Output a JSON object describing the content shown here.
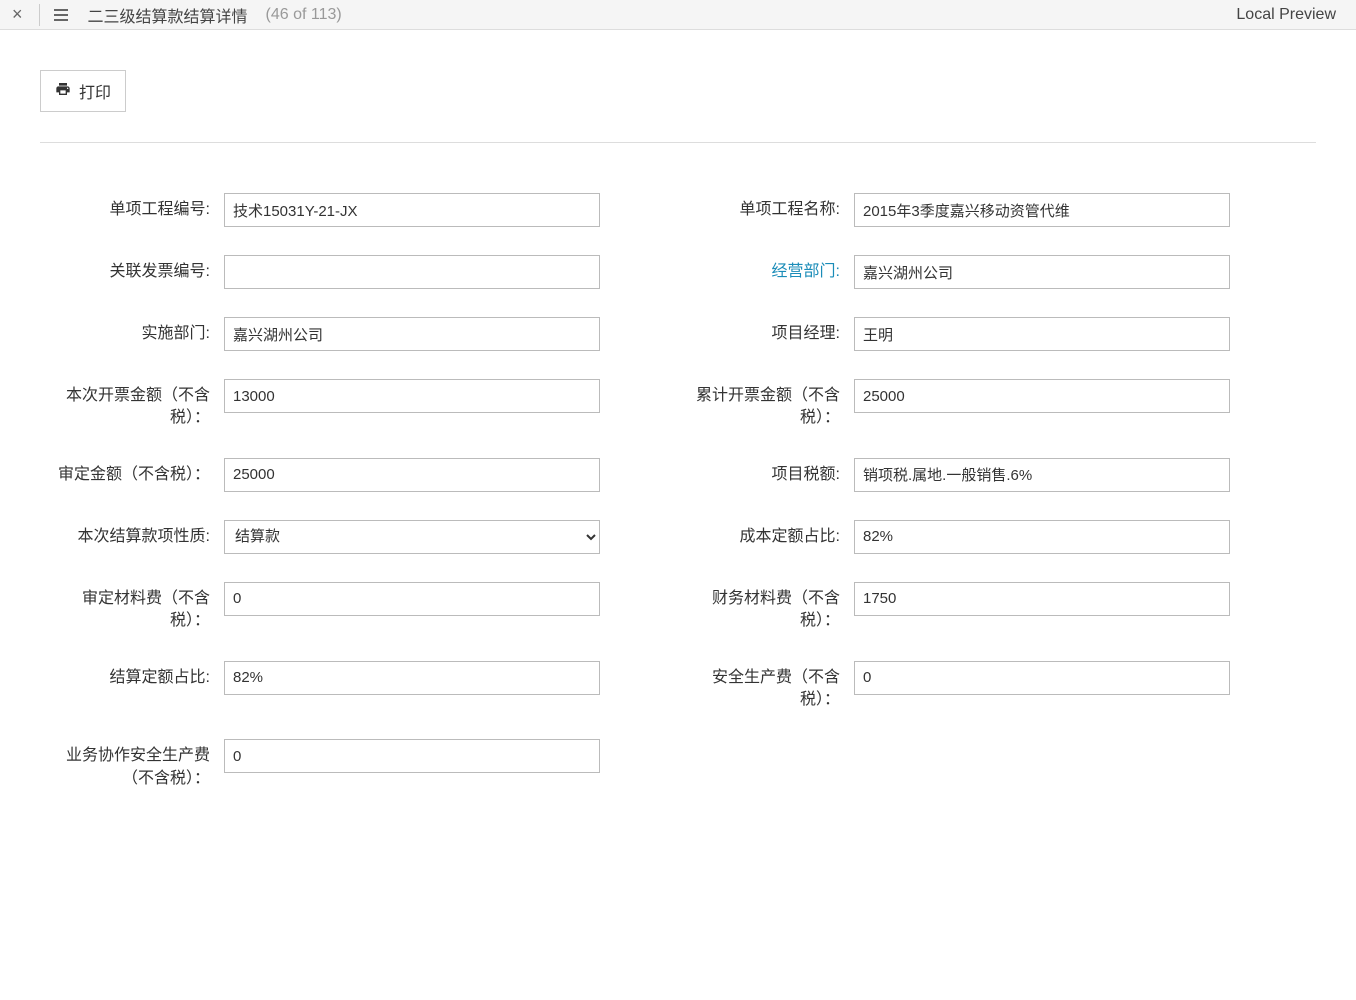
{
  "topbar": {
    "title": "二三级结算款结算详情",
    "count": "(46 of 113)",
    "preview": "Local Preview"
  },
  "toolbar": {
    "print_label": "打印"
  },
  "form": {
    "project_code_label": "单项工程编号:",
    "project_code_value": "技术15031Y-21-JX",
    "project_name_label": "单项工程名称:",
    "project_name_value": "2015年3季度嘉兴移动资管代维",
    "invoice_ref_label": "关联发票编号:",
    "invoice_ref_value": "",
    "business_dept_label": "经营部门:",
    "business_dept_value": "嘉兴湖州公司",
    "impl_dept_label": "实施部门:",
    "impl_dept_value": "嘉兴湖州公司",
    "pm_label": "项目经理:",
    "pm_value": "王明",
    "this_invoice_amt_label": "本次开票金额（不含税）：",
    "this_invoice_amt_value": "13000",
    "cum_invoice_amt_label": "累计开票金额（不含税）：",
    "cum_invoice_amt_value": "25000",
    "approved_amt_label": "审定金额（不含税）：",
    "approved_amt_value": "25000",
    "project_tax_label": "项目税额:",
    "project_tax_value": "销项税.属地.一般销售.6%",
    "settle_nature_label": "本次结算款项性质:",
    "settle_nature_value": "结算款",
    "cost_quota_ratio_label": "成本定额占比:",
    "cost_quota_ratio_value": "82%",
    "approved_material_label": "审定材料费（不含税）：",
    "approved_material_value": "0",
    "finance_material_label": "财务材料费（不含税）：",
    "finance_material_value": "1750",
    "settle_quota_ratio_label": "结算定额占比:",
    "settle_quota_ratio_value": "82%",
    "safety_fee_label": "安全生产费（不含税）：",
    "safety_fee_value": "0",
    "coop_safety_fee_label": "业务协作安全生产费（不含税）：",
    "coop_safety_fee_value": "0"
  }
}
